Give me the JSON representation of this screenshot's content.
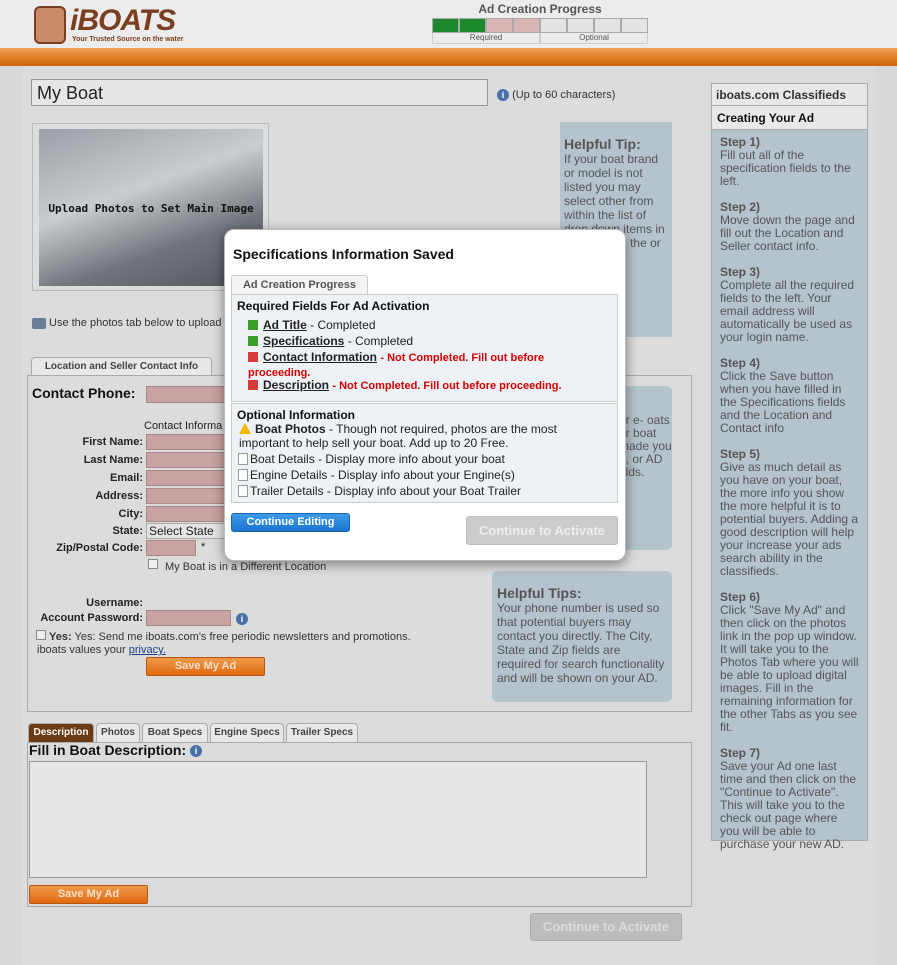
{
  "header": {
    "logo_word": "iBOATS",
    "logo_tagline": "Your Trusted Source on the water",
    "progress_title": "Ad Creation Progress",
    "progress_required": "Required",
    "progress_optional": "Optional",
    "progress_cells": [
      "g",
      "g",
      "r",
      "r",
      "o",
      "o",
      "o",
      "o"
    ]
  },
  "title_field": {
    "value": "My Boat",
    "hint": "(Up to 60 characters)"
  },
  "photo": {
    "label": "Upload Photos to Set Main Image",
    "hint": "Use the photos tab below to upload p"
  },
  "helpful_tip": {
    "heading": "Helpful Tip:",
    "text": "If your boat brand or model is not listed you may select other from within the list of drop down items in the box You the or blank"
  },
  "location_tab": "Location and Seller Contact Info",
  "contact": {
    "phone_label": "Contact Phone:",
    "section_label": "Contact Informa",
    "first_name": "First Name:",
    "last_name": "Last Name:",
    "email": "Email:",
    "address": "Address:",
    "city": "City:",
    "state": "State:",
    "state_value": "Select State",
    "zip": "Zip/Postal Code:",
    "zip_required": "*",
    "diff_location": "My Boat is in a Different Location",
    "username": "Username:",
    "password": "Account Password:",
    "newsletter_yes": "Yes:",
    "newsletter_text": "Yes: Send me iboats.com's free periodic newsletters and promotions. iboats values your",
    "privacy_link": "privacy.",
    "save_button": "Save My Ad"
  },
  "email_box": {
    "text": "ur e- oats ur boat made you e, or AD elds."
  },
  "tips2": {
    "heading": "Helpful Tips:",
    "text": "Your phone number is used so that potential buyers may contact you directly. The City, State and Zip fields are required for search functionality and will be shown on your AD."
  },
  "bottom_tabs": [
    "Description",
    "Photos",
    "Boat Specs",
    "Engine Specs",
    "Trailer Specs"
  ],
  "description": {
    "title": "Fill in Boat Description:",
    "save_button": "Save My Ad",
    "activate_button": "Continue to Activate"
  },
  "sidebar": {
    "header": "iboats.com Classifieds",
    "subheader": "Creating Your Ad",
    "steps": [
      {
        "title": "Step 1)",
        "text": "Fill out all of the specification fields to the left."
      },
      {
        "title": "Step 2)",
        "text": "Move down the page and fill out the Location and Seller contact info."
      },
      {
        "title": "Step 3)",
        "text": "Complete all the required fields to the left. Your email address will automatically be used as your login name."
      },
      {
        "title": "Step 4)",
        "text": "Click the Save button when you have filled in the Specifications fields and the Location and Contact info"
      },
      {
        "title": "Step 5)",
        "text": "Give as much detail as you have on your boat, the more info you show the more helpful it is to potential buyers. Adding a good description will help your increase your ads search ability in the classifieds."
      },
      {
        "title": "Step 6)",
        "text": "Click \"Save My Ad\" and then click on the photos link in the pop up window. It will take you to the Photos Tab where you will be able to upload digital images. Fill in the remaining information for the other Tabs as you see fit."
      },
      {
        "title": "Step 7)",
        "text": "Save your Ad one last time and then click on the \"Continue to Activate\". This will take you to the check out page where you will be able to purchase your new AD."
      }
    ]
  },
  "modal": {
    "title": "Specifications Information Saved",
    "tab": "Ad Creation Progress",
    "required_heading": "Required Fields For Ad Activation",
    "required_items": [
      {
        "name": "Ad Title",
        "status": "- Completed",
        "done": true
      },
      {
        "name": "Specifications",
        "status": "- Completed",
        "done": true
      },
      {
        "name": "Contact Information",
        "status": "- Not Completed. Fill out before proceeding.",
        "done": false
      },
      {
        "name": "Description",
        "status": "- Not Completed. Fill out before proceeding.",
        "done": false
      }
    ],
    "optional_heading": "Optional Information",
    "optional_items": [
      {
        "name": "Boat Photos",
        "text": " - Though not required, photos are the most important to help sell your boat. Add up to 20 Free."
      },
      {
        "name": "Boat Details",
        "text": " - Display more info about your boat"
      },
      {
        "name": "Engine Details",
        "text": " - Display info about your Engine(s)"
      },
      {
        "name": "Trailer Details",
        "text": " - Display info about your Boat Trailer"
      }
    ],
    "continue_editing": "Continue Editing",
    "continue_activate": "Continue to Activate"
  }
}
